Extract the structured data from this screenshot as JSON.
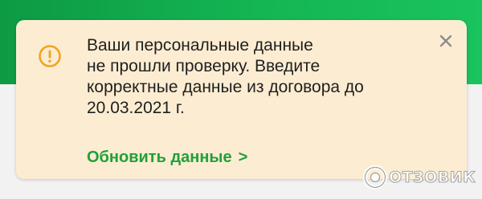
{
  "alert": {
    "message_lines": [
      "Ваши персональные данные",
      "не прошли проверку. Введите",
      "корректные данные из договора до",
      "20.03.2021 г."
    ],
    "action_label": "Обновить данные",
    "action_chevron": ">",
    "warning_icon": "exclamation-circle-icon",
    "close_icon": "close-icon"
  },
  "watermark": {
    "text": "ОТЗОВИК",
    "logo": "otzovik-logo-icon"
  },
  "colors": {
    "header_green": "#14b653",
    "card_background": "#fcedd2",
    "warning_orange": "#f2a41b",
    "link_green": "#21a038",
    "close_gray": "#8c8c8c"
  }
}
